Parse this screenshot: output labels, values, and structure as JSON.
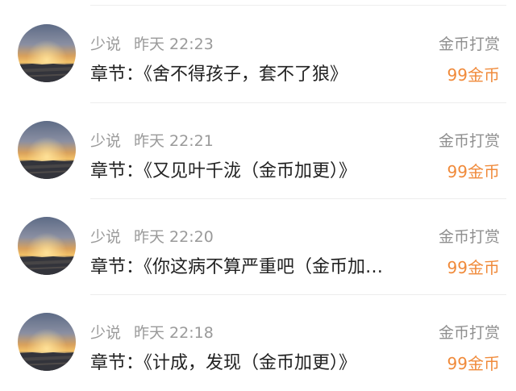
{
  "accent_color": "#f08a3a",
  "items": [
    {
      "user": "少说",
      "time": "昨天 22:23",
      "chapter_prefix": "章节：",
      "chapter": "《舍不得孩子，套不了狼》",
      "reward_type": "金币打赏",
      "reward_amount": "99金币",
      "avatar": "sunset-landscape-avatar"
    },
    {
      "user": "少说",
      "time": "昨天 22:21",
      "chapter_prefix": "章节：",
      "chapter": "《又见叶千泷（金币加更）》",
      "reward_type": "金币打赏",
      "reward_amount": "99金币",
      "avatar": "sunset-landscape-avatar"
    },
    {
      "user": "少说",
      "time": "昨天 22:20",
      "chapter_prefix": "章节：",
      "chapter": "《你这病不算严重吧（金币加…",
      "reward_type": "金币打赏",
      "reward_amount": "99金币",
      "avatar": "sunset-landscape-avatar"
    },
    {
      "user": "少说",
      "time": "昨天 22:18",
      "chapter_prefix": "章节：",
      "chapter": "《计成，发现（金币加更）》",
      "reward_type": "金币打赏",
      "reward_amount": "99金币",
      "avatar": "sunset-landscape-avatar"
    }
  ]
}
